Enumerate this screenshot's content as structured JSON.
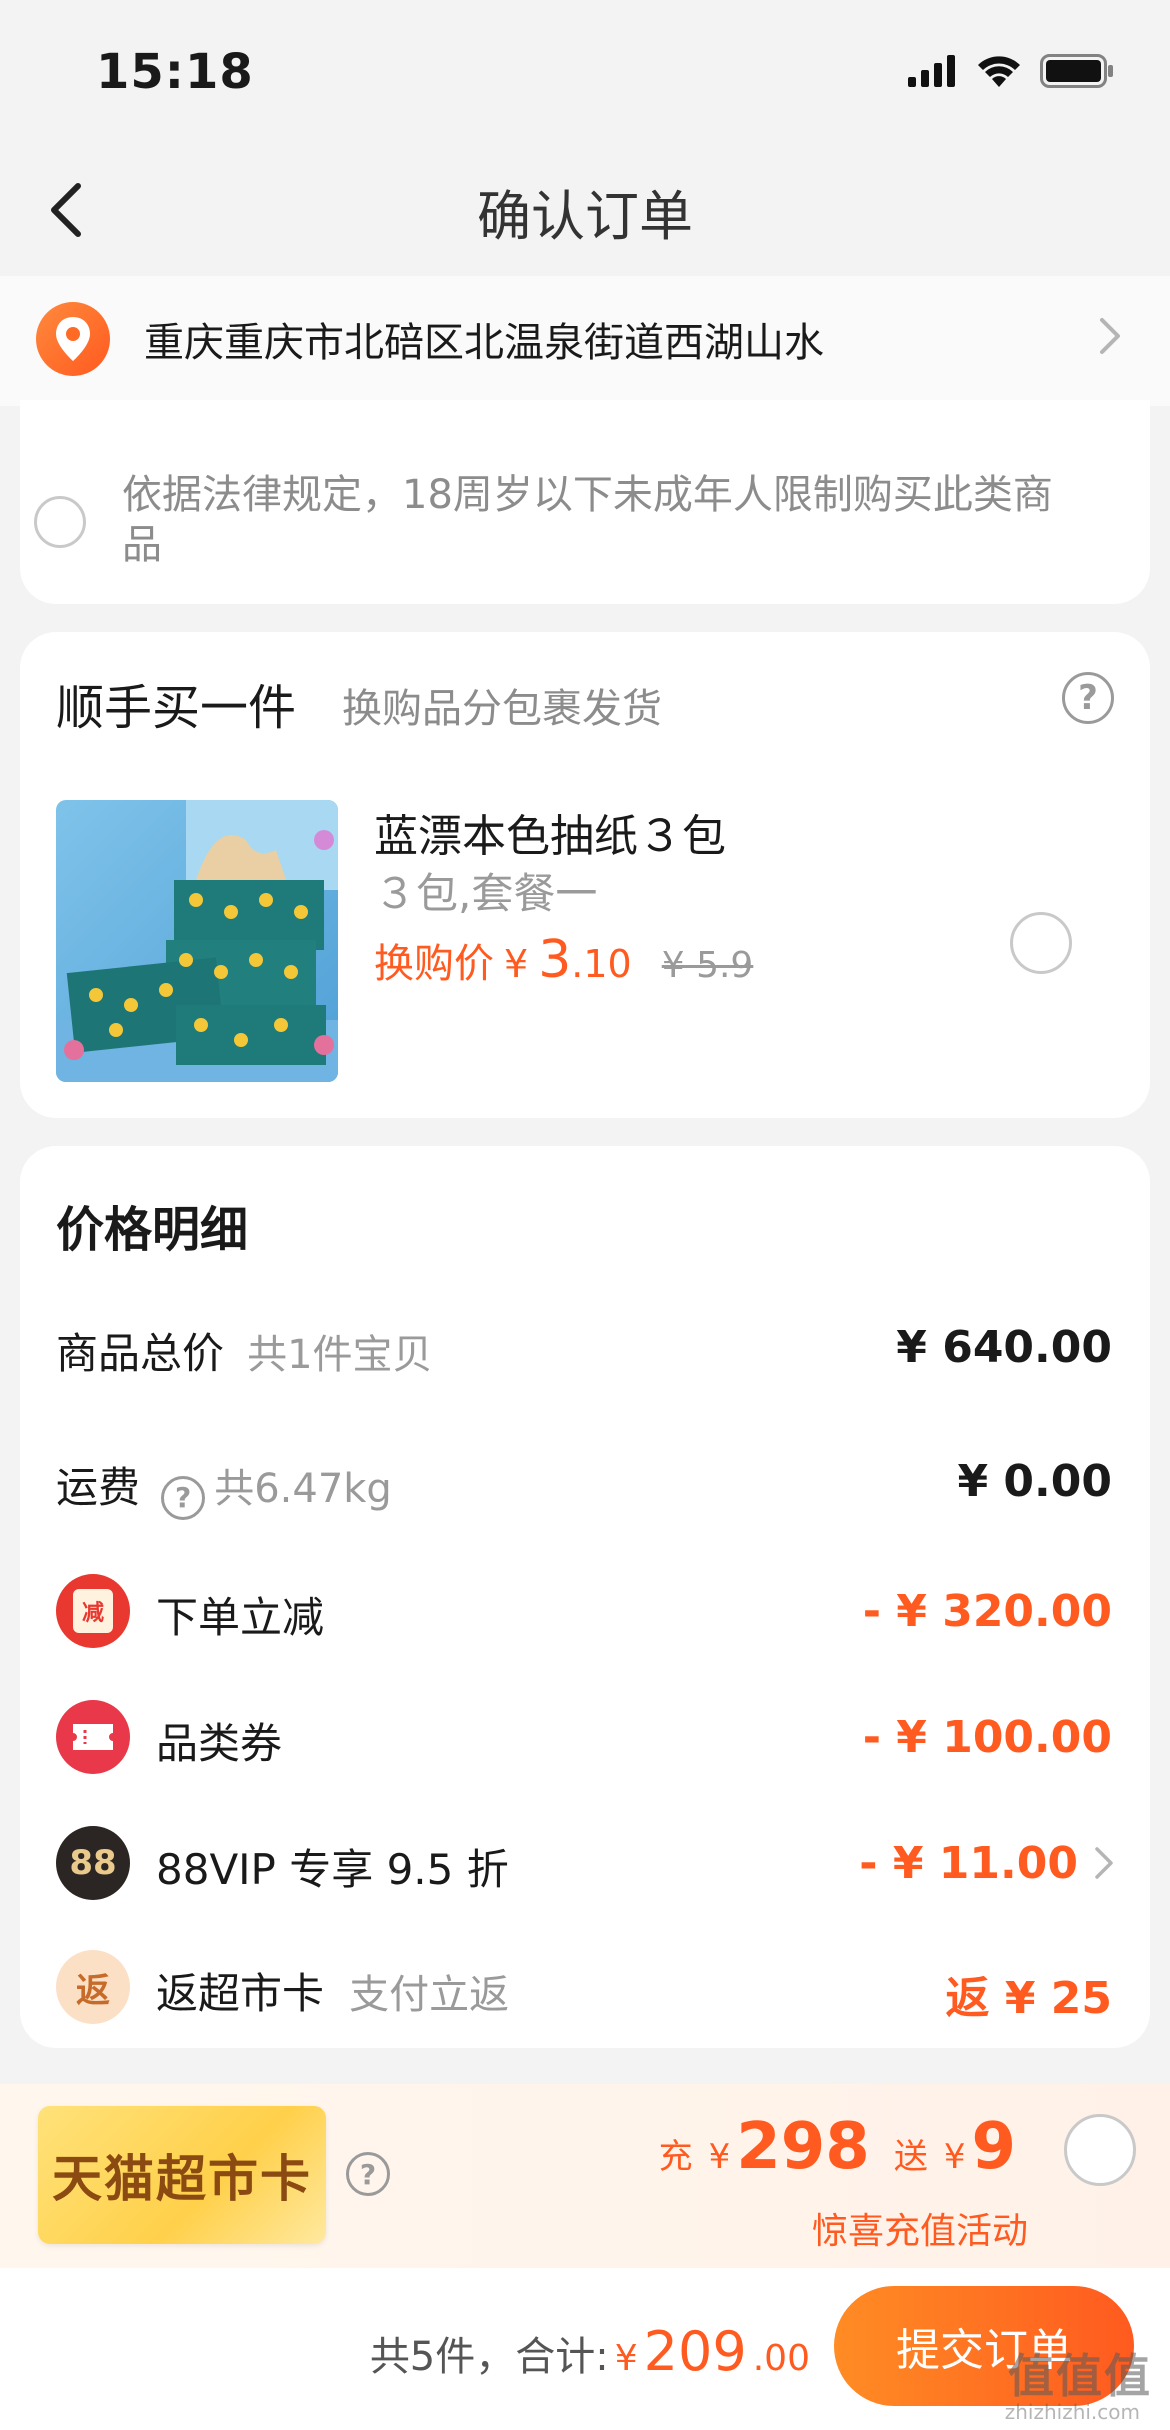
{
  "status_bar": {
    "time": "15:18"
  },
  "nav": {
    "title": "确认订单"
  },
  "address": {
    "text": "重庆重庆市北碚区北温泉街道西湖山水"
  },
  "age_notice": {
    "text": "依据法律规定，18周岁以下未成年人限制购买此类商品"
  },
  "addon": {
    "title": "顺手买一件",
    "subtitle": "换购品分包裹发货",
    "product": {
      "name": "蓝漂本色抽纸３包",
      "spec": "３包,套餐一",
      "price_label": "换购价",
      "currency": "¥",
      "price_int": "3",
      "price_dec": ".10",
      "original_price": "¥ 5.9"
    }
  },
  "price_detail": {
    "title": "价格明细",
    "rows": [
      {
        "label": "商品总价",
        "sub": "共1件宝贝",
        "value": "¥ 640.00"
      },
      {
        "label": "运费",
        "sub": "共6.47kg",
        "value": "¥ 0.00"
      },
      {
        "label": "下单立减",
        "badge": "减",
        "value": "- ¥ 320.00"
      },
      {
        "label": "品类券",
        "value": "- ¥ 100.00"
      },
      {
        "label": "88VIP 专享 9.5 折",
        "badge": "88",
        "value": "- ¥ 11.00"
      },
      {
        "label": "返超市卡",
        "badge": "返",
        "sub": "支付立返",
        "value": "返 ¥ 25"
      }
    ]
  },
  "tmall_card": {
    "label": "天猫超市卡",
    "recharge_prefix": "充",
    "currency": "¥",
    "recharge_amount": "298",
    "gift_prefix": "送",
    "gift_amount": "9",
    "activity": "惊喜充值活动"
  },
  "bottom_bar": {
    "count_label": "共5件，合计:",
    "currency": "¥",
    "total_int": "209",
    "total_dec": ".00",
    "submit_label": "提交订单"
  },
  "watermark": {
    "text": "值值值",
    "sub": "zhizhizhi.com"
  },
  "colors": {
    "accent": "#ff5a1f",
    "muted": "#9a9a9a",
    "background": "#f3f3f3"
  }
}
